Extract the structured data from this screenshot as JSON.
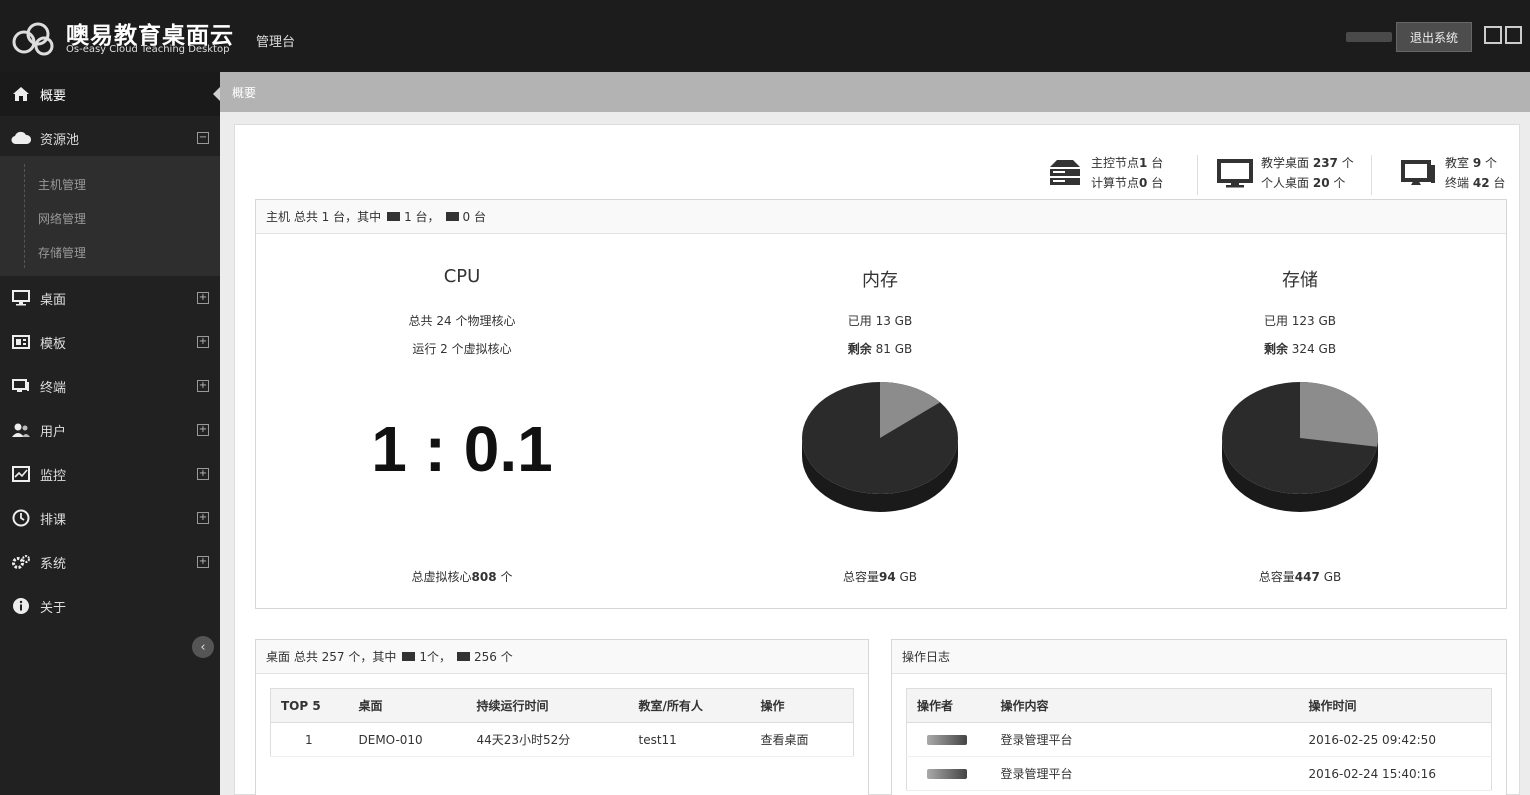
{
  "header": {
    "brand_title": "噢易教育桌面云",
    "brand_subtitle": "Os-easy Cloud Teaching Desktop",
    "admin_label": "管理台",
    "logout_label": "退出系统"
  },
  "sidebar": {
    "items": [
      {
        "label": "概要",
        "icon": "home-icon"
      },
      {
        "label": "资源池",
        "icon": "cloud-icon"
      },
      {
        "label": "桌面",
        "icon": "monitor-icon"
      },
      {
        "label": "模板",
        "icon": "template-icon"
      },
      {
        "label": "终端",
        "icon": "terminal-icon"
      },
      {
        "label": "用户",
        "icon": "users-icon"
      },
      {
        "label": "监控",
        "icon": "chart-icon"
      },
      {
        "label": "排课",
        "icon": "clock-icon"
      },
      {
        "label": "系统",
        "icon": "gears-icon"
      },
      {
        "label": "关于",
        "icon": "info-icon"
      }
    ],
    "submenu": [
      "主机管理",
      "网络管理",
      "存储管理"
    ]
  },
  "breadcrumb": "概要",
  "stats": {
    "node_line1_prefix": "主控节点",
    "node_line1_value": "1",
    "node_line1_suffix": "台",
    "node_line2_prefix": "计算节点",
    "node_line2_value": "0",
    "node_line2_suffix": "台",
    "desk_line1_prefix": "教学桌面",
    "desk_line1_value": "237",
    "desk_line1_suffix": "个",
    "desk_line2_prefix": "个人桌面",
    "desk_line2_value": "20",
    "desk_line2_suffix": "个",
    "room_line1_prefix": "教室",
    "room_line1_value": "9",
    "room_line1_suffix": "个",
    "room_line2_prefix": "终端",
    "room_line2_value": "42",
    "room_line2_suffix": "台"
  },
  "host_panel": {
    "head_prefix": "主机  总共 1 台，其中",
    "head_count_a": "1 台，",
    "head_count_b": "0 台",
    "cpu": {
      "title": "CPU",
      "line1": "总共 24 个物理核心",
      "line2": "运行 2 个虚拟核心",
      "ratio": "1 : 0.1",
      "footer_prefix": "总虚拟核心",
      "footer_value": "808",
      "footer_suffix": "个"
    },
    "memory": {
      "title": "内存",
      "line1": "已用 13 GB",
      "line2_prefix": "剩余",
      "line2_value": "81 GB",
      "footer_prefix": "总容量",
      "footer_value": "94",
      "footer_suffix": "GB",
      "used_fraction": 0.14
    },
    "storage": {
      "title": "存储",
      "line1": "已用 123 GB",
      "line2_prefix": "剩余",
      "line2_value": "324 GB",
      "footer_prefix": "总容量",
      "footer_value": "447",
      "footer_suffix": "GB",
      "used_fraction": 0.275
    }
  },
  "desktop_panel": {
    "head_prefix": "桌面  总共 257 个，其中",
    "head_count_a": "1个，",
    "head_count_b": "256 个",
    "columns": [
      "TOP 5",
      "桌面",
      "持续运行时间",
      "教室/所有人",
      "操作"
    ],
    "rows": [
      {
        "rank": "1",
        "desktop": "DEMO-010",
        "uptime": "44天23小时52分",
        "owner": "test11",
        "action": "查看桌面"
      }
    ]
  },
  "log_panel": {
    "title": "操作日志",
    "columns": [
      "操作者",
      "操作内容",
      "操作时间"
    ],
    "rows": [
      {
        "content": "登录管理平台",
        "time": "2016-02-25 09:42:50"
      },
      {
        "content": "登录管理平台",
        "time": "2016-02-24 15:40:16"
      }
    ]
  },
  "colors": {
    "pie_dark": "#2b2b2b",
    "pie_light": "#8c8c8c",
    "header_bg": "#1c1c1c",
    "sidebar_bg": "#212121"
  }
}
